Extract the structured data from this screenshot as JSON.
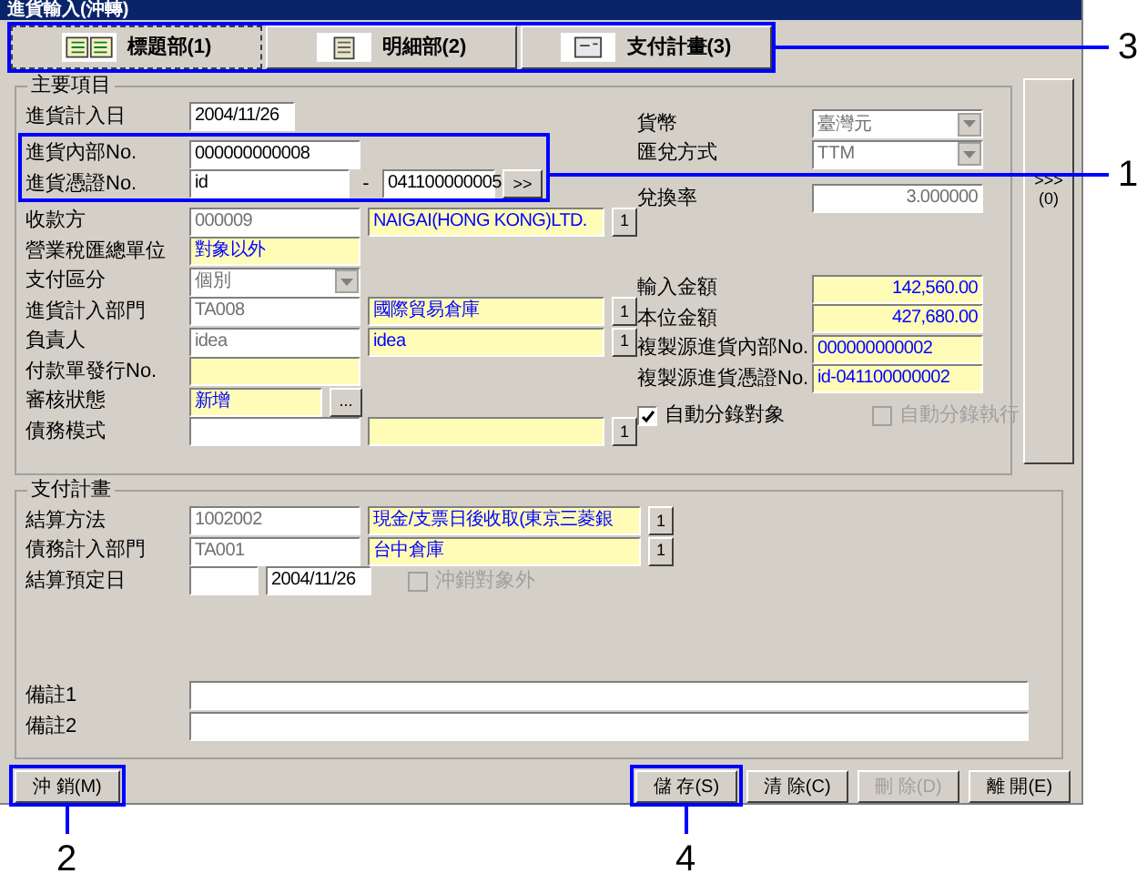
{
  "window": {
    "title": "進貨輸入(沖轉)"
  },
  "tabs": [
    {
      "label": "標題部(1)",
      "selected": true
    },
    {
      "label": "明細部(2)",
      "selected": false
    },
    {
      "label": "支付計畫(3)",
      "selected": false
    }
  ],
  "main_section": {
    "legend": "主要項目",
    "left_rows": [
      {
        "label": "進貨計入日",
        "items": [
          {
            "kind": "input",
            "value": "2004/11/26"
          }
        ]
      },
      {
        "label": "進貨內部No.",
        "items": [
          {
            "kind": "input",
            "value": "000000000008"
          }
        ]
      },
      {
        "label": "進貨憑證No.",
        "items": [
          {
            "kind": "input",
            "value": "id"
          },
          {
            "kind": "text",
            "value": "-"
          },
          {
            "kind": "input",
            "value": "041100000005"
          },
          {
            "kind": "button",
            "value": ">>"
          }
        ]
      },
      {
        "label": "收款方",
        "items": [
          {
            "kind": "readonly",
            "value": "000009"
          },
          {
            "kind": "highlight",
            "value": "NAIGAI(HONG KONG)LTD."
          },
          {
            "kind": "button",
            "value": "1"
          }
        ]
      },
      {
        "label": "營業稅匯總單位",
        "items": [
          {
            "kind": "highlight",
            "value": "對象以外"
          }
        ]
      },
      {
        "label": "支付區分",
        "items": [
          {
            "kind": "dropdown",
            "value": "個別"
          }
        ]
      },
      {
        "label": "進貨計入部門",
        "items": [
          {
            "kind": "readonly",
            "value": "TA008"
          },
          {
            "kind": "highlight",
            "value": "國際貿易倉庫"
          },
          {
            "kind": "button",
            "value": "1"
          }
        ]
      },
      {
        "label": "負責人",
        "items": [
          {
            "kind": "readonly",
            "value": "idea"
          },
          {
            "kind": "highlight",
            "value": "idea"
          },
          {
            "kind": "button",
            "value": "1"
          }
        ]
      },
      {
        "label": "付款單發行No.",
        "items": [
          {
            "kind": "highlight"
          }
        ]
      },
      {
        "label": "審核狀態",
        "items": [
          {
            "kind": "highlight",
            "value": "新增"
          },
          {
            "kind": "button",
            "value": "..."
          }
        ]
      },
      {
        "label": "債務模式",
        "items": [
          {
            "kind": "input"
          },
          {
            "kind": "highlight"
          },
          {
            "kind": "button",
            "value": "1"
          }
        ]
      }
    ],
    "right_rows": [
      {
        "label": "貨幣",
        "items": [
          {
            "kind": "dropdown",
            "value": "臺灣元"
          }
        ]
      },
      {
        "label": "匯兌方式",
        "items": [
          {
            "kind": "dropdown",
            "value": "TTM"
          }
        ]
      },
      {
        "label": "兌換率",
        "items": [
          {
            "kind": "readonly_number",
            "value": "3.000000"
          }
        ]
      },
      {},
      {},
      {
        "label": "輸入金額",
        "items": [
          {
            "kind": "highlight_number",
            "value": "142,560.00"
          }
        ]
      },
      {
        "label": "本位金額",
        "items": [
          {
            "kind": "highlight_number",
            "value": "427,680.00"
          }
        ]
      },
      {
        "label": "複製源進貨內部No.",
        "items": [
          {
            "kind": "highlight",
            "value": "000000000002"
          }
        ]
      },
      {
        "label": "複製源進貨憑證No.",
        "items": [
          {
            "kind": "highlight",
            "value": "id-041100000002"
          }
        ]
      },
      {
        "checkboxes": [
          {
            "label": "自動分錄對象",
            "checked": true,
            "disabled": false
          },
          {
            "label": "自動分錄執行",
            "checked": false,
            "disabled": true
          }
        ]
      }
    ]
  },
  "side_button": {
    "arrows": ">>>",
    "label": "(0)"
  },
  "payment_section": {
    "legend": "支付計畫",
    "rows": [
      {
        "label": "結算方法",
        "items": [
          {
            "kind": "readonly",
            "value": "1002002"
          },
          {
            "kind": "highlight",
            "value": "現金/支票日後收取(東京三菱銀"
          },
          {
            "kind": "button",
            "value": "1"
          }
        ]
      },
      {
        "label": "債務計入部門",
        "items": [
          {
            "kind": "readonly",
            "value": "TA001"
          },
          {
            "kind": "highlight",
            "value": "台中倉庫"
          },
          {
            "kind": "button",
            "value": "1"
          }
        ]
      },
      {
        "label": "結算預定日",
        "items": [
          {
            "kind": "input"
          },
          {
            "kind": "input",
            "value": "2004/11/26"
          },
          {
            "kind": "checkbox",
            "value": "沖銷對象外",
            "checked": false,
            "disabled": true
          }
        ]
      }
    ],
    "notes": [
      {
        "label": "備註1"
      },
      {
        "label": "備註2"
      }
    ]
  },
  "buttons_left": [
    {
      "label": "沖 銷(M)",
      "disabled": false
    }
  ],
  "buttons_right": [
    {
      "label": "儲 存(S)",
      "disabled": false
    },
    {
      "label": "清 除(C)",
      "disabled": false
    },
    {
      "label": "刪 除(D)",
      "disabled": true
    },
    {
      "label": "離 開(E)",
      "disabled": false
    }
  ],
  "callouts": [
    {
      "number": "1"
    },
    {
      "number": "2"
    },
    {
      "number": "3"
    },
    {
      "number": "4"
    }
  ]
}
